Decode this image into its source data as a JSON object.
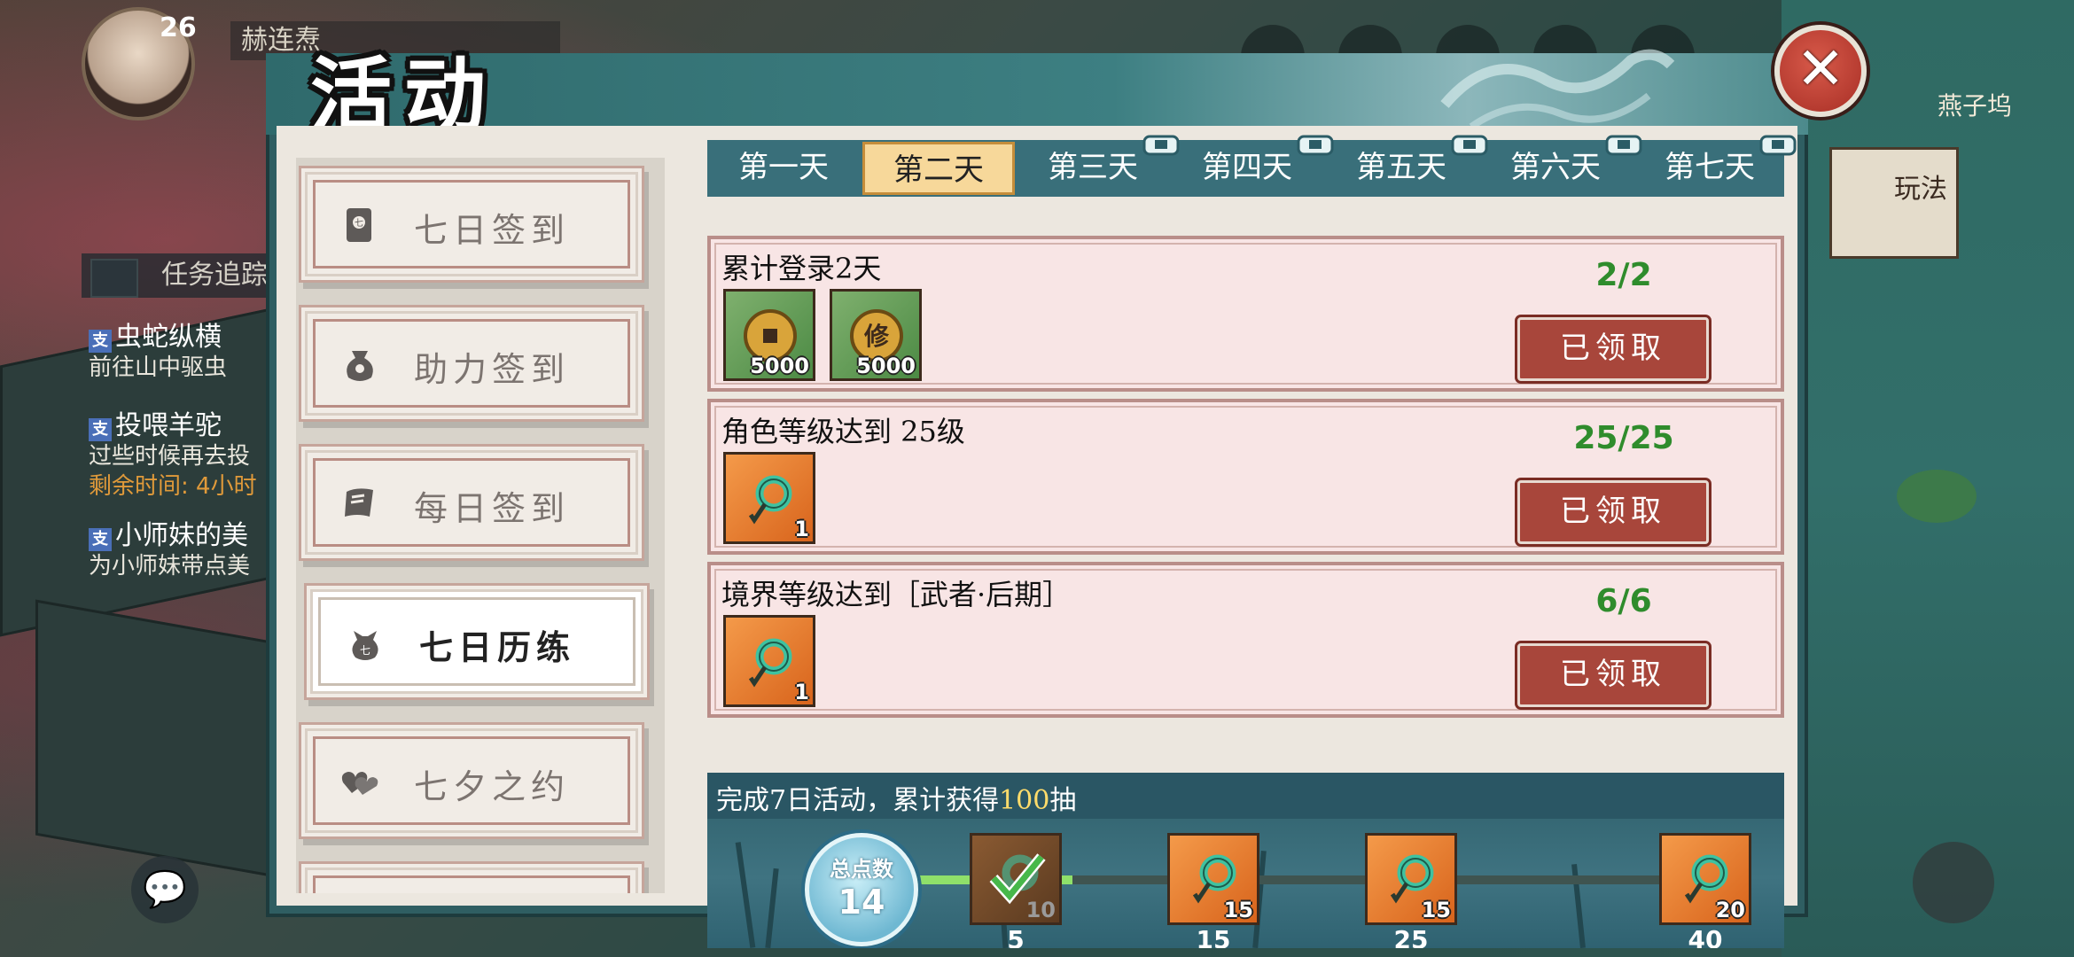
{
  "background": {
    "player_level": "26",
    "player_name": "赫连焘",
    "location_label": "燕子坞",
    "quest_header": "任务追踪",
    "quests": [
      {
        "title": "虫蛇纵横",
        "desc": "前往山中驱虫"
      },
      {
        "title": "投喂羊驼",
        "desc": "过些时候再去投",
        "extra": "剩余时间: 4小时"
      },
      {
        "title": "小师妹的美",
        "desc": "为小师妹带点美"
      }
    ],
    "right_button": "玩法",
    "chat_icon": "chat-bubble-icon",
    "chat_glyph": "💬"
  },
  "dialog": {
    "title": "活动",
    "close_glyph": "✕",
    "menu": [
      {
        "label": "七日签到",
        "icon": "scroll-seal-icon",
        "active": false
      },
      {
        "label": "助力签到",
        "icon": "pouch-icon",
        "active": false
      },
      {
        "label": "每日签到",
        "icon": "scroll-icon",
        "active": false
      },
      {
        "label": "七日历练",
        "icon": "bag-seven-icon",
        "active": true
      },
      {
        "label": "七夕之约",
        "icon": "double-heart-icon",
        "active": false
      }
    ],
    "day_tabs": [
      {
        "label": "第一天",
        "active": false,
        "locked": false
      },
      {
        "label": "第二天",
        "active": true,
        "locked": false
      },
      {
        "label": "第三天",
        "active": false,
        "locked": true
      },
      {
        "label": "第四天",
        "active": false,
        "locked": true
      },
      {
        "label": "第五天",
        "active": false,
        "locked": true
      },
      {
        "label": "第六天",
        "active": false,
        "locked": true
      },
      {
        "label": "第七天",
        "active": false,
        "locked": true
      }
    ],
    "tasks": [
      {
        "title": "累计登录2天",
        "progress": "2/2",
        "button": "已领取",
        "rewards": [
          {
            "icon": "copper-coin-icon",
            "count": "5000",
            "style": "green"
          },
          {
            "icon": "cultivation-coin-icon",
            "count": "5000",
            "style": "green"
          }
        ]
      },
      {
        "title": "角色等级达到 25级",
        "progress": "25/25",
        "button": "已领取",
        "rewards": [
          {
            "icon": "jade-pendant-icon",
            "count": "1",
            "style": "orange"
          }
        ]
      },
      {
        "title": "境界等级达到［武者·后期］",
        "progress": "6/6",
        "button": "已领取",
        "rewards": [
          {
            "icon": "jade-pendant-icon",
            "count": "1",
            "style": "orange"
          }
        ]
      }
    ],
    "bottom": {
      "text_prefix": "完成7日活动，累计获得",
      "text_highlight": "100",
      "text_suffix": "抽",
      "points_label": "总点数",
      "points_value": "14",
      "progress_fraction": 0.2,
      "milestones": [
        {
          "threshold": "5",
          "count": "10",
          "claimed": true,
          "icon": "check-icon"
        },
        {
          "threshold": "15",
          "count": "15",
          "claimed": false,
          "icon": "jade-pendant-icon"
        },
        {
          "threshold": "25",
          "count": "15",
          "claimed": false,
          "icon": "jade-pendant-icon"
        },
        {
          "threshold": "40",
          "count": "20",
          "claimed": false,
          "icon": "jade-pendant-icon"
        }
      ]
    }
  },
  "colors": {
    "progress_green": "#2f8c2c",
    "claim_red": "#a8463b",
    "tab_active": "#f7d89a",
    "highlight_yellow": "#ffdc6b"
  }
}
